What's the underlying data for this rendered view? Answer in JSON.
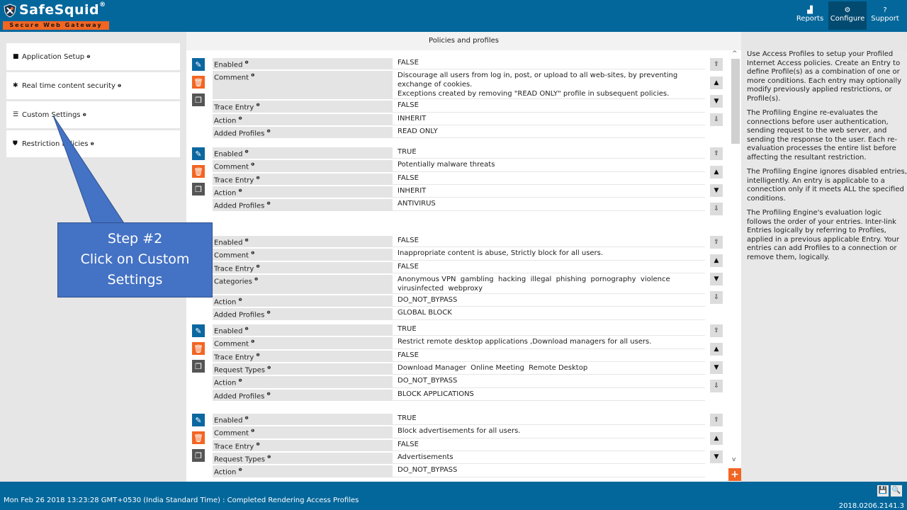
{
  "brand": {
    "title": "SafeSquid",
    "registered": "®",
    "tagline": "Secure Web Gateway"
  },
  "nav": [
    {
      "label": "Reports",
      "icon": "area-chart-icon",
      "glyph": "▟",
      "active": false
    },
    {
      "label": "Configure",
      "icon": "cogs-icon",
      "glyph": "⚙",
      "active": true
    },
    {
      "label": "Support",
      "icon": "question-circle-icon",
      "glyph": "?",
      "active": false
    }
  ],
  "sidebar": {
    "items": [
      {
        "label": "Application Setup",
        "icon": "briefcase-icon",
        "glyph": "■",
        "info": "❶"
      },
      {
        "label": "Real time content security",
        "icon": "bug-icon",
        "glyph": "✱",
        "info": "❶"
      },
      {
        "label": "Custom Settings",
        "icon": "sliders-icon",
        "glyph": "☰",
        "info": "❶"
      },
      {
        "label": "Restriction Policies",
        "icon": "shield-icon",
        "glyph": "⛊",
        "info": "❶"
      }
    ]
  },
  "main": {
    "title": "Policies and profiles",
    "entries": [
      {
        "rows": [
          {
            "label": "Enabled",
            "value": "FALSE"
          },
          {
            "label": "Comment",
            "value": "Discourage all users from log in, post, or upload to all web-sites, by preventing exchange of cookies.\nExceptions created by removing \"READ ONLY\" profile in subsequent policies."
          },
          {
            "label": "Trace Entry",
            "value": "FALSE"
          },
          {
            "label": "Action",
            "value": "INHERIT"
          },
          {
            "label": "Added Profiles",
            "value": "READ ONLY"
          }
        ]
      },
      {
        "rows": [
          {
            "label": "Enabled",
            "value": "TRUE"
          },
          {
            "label": "Comment",
            "value": "Potentially malware threats"
          },
          {
            "label": "Trace Entry",
            "value": "FALSE"
          },
          {
            "label": "Action",
            "value": "INHERIT"
          },
          {
            "label": "Added Profiles",
            "value": "ANTIVIRUS"
          }
        ]
      },
      {
        "rows": [
          {
            "label": "Enabled",
            "value": "FALSE"
          },
          {
            "label": "Comment",
            "value": "Inappropriate content is abuse, Strictly block for all users."
          },
          {
            "label": "Trace Entry",
            "value": "FALSE"
          },
          {
            "label": "Categories",
            "value": "Anonymous VPN  gambling  hacking  illegal  phishing  pornography  violence\nvirusinfected  webproxy"
          },
          {
            "label": "Action",
            "value": "DO_NOT_BYPASS"
          },
          {
            "label": "Added Profiles",
            "value": "GLOBAL BLOCK"
          }
        ]
      },
      {
        "rows": [
          {
            "label": "Enabled",
            "value": "TRUE"
          },
          {
            "label": "Comment",
            "value": "Restrict remote desktop applications ,Download managers for all users."
          },
          {
            "label": "Trace Entry",
            "value": "FALSE"
          },
          {
            "label": "Request Types",
            "value": "Download Manager  Online Meeting  Remote Desktop"
          },
          {
            "label": "Action",
            "value": "DO_NOT_BYPASS"
          },
          {
            "label": "Added Profiles",
            "value": "BLOCK APPLICATIONS"
          }
        ]
      },
      {
        "rows": [
          {
            "label": "Enabled",
            "value": "TRUE"
          },
          {
            "label": "Comment",
            "value": "Block advertisements for all users."
          },
          {
            "label": "Trace Entry",
            "value": "FALSE"
          },
          {
            "label": "Request Types",
            "value": "Advertisements"
          },
          {
            "label": "Action",
            "value": "DO_NOT_BYPASS"
          }
        ]
      }
    ],
    "actions": {
      "edit": {
        "icon": "edit-icon",
        "glyph": "✎"
      },
      "delete": {
        "icon": "trash-icon",
        "glyph": "🗑"
      },
      "copy": {
        "icon": "copy-icon",
        "glyph": "❐"
      }
    },
    "movers": [
      {
        "icon": "move-to-top-icon",
        "glyph": "⇧"
      },
      {
        "icon": "move-up-icon",
        "glyph": "▲"
      },
      {
        "icon": "move-down-icon",
        "glyph": "▼"
      },
      {
        "icon": "move-to-bottom-icon",
        "glyph": "⇩"
      }
    ],
    "add_glyph": "+"
  },
  "help": {
    "paragraphs": [
      "Use Access Profiles to setup your Profiled Internet Access policies. Create an Entry to define Profile(s) as a combination of one or more conditions. Each entry may optionally modify previously applied restrictions, or Profile(s).",
      "The Profiling Engine re-evaluates the connections before user authentication, sending request to the web server, and sending the response to the user. Each re-evaluation processes the entire list before affecting the resultant restriction.",
      "The Profiling Engine ignores disabled entries, intelligently. An entry is applicable to a connection only if it meets ALL the specified conditions.",
      "The Profiling Engine's evaluation logic follows the order of your entries. Inter-link Entries logically by referring to Profiles, applied in a previous applicable Entry. Your entries can add Profiles to a connection or remove them, logically."
    ]
  },
  "footer": {
    "status": "Mon Feb 26 2018 13:23:28 GMT+0530 (India Standard Time) : Completed Rendering Access Profiles",
    "version": "2018.0206.2141.3",
    "save_glyph": "💾",
    "search_glyph": "🔍"
  },
  "callout": {
    "line1": "Step #2",
    "line2": "Click on Custom",
    "line3": "Settings"
  },
  "colors": {
    "brand_blue": "#04679b",
    "accent_orange": "#f26522",
    "callout_blue": "#4472c4"
  }
}
